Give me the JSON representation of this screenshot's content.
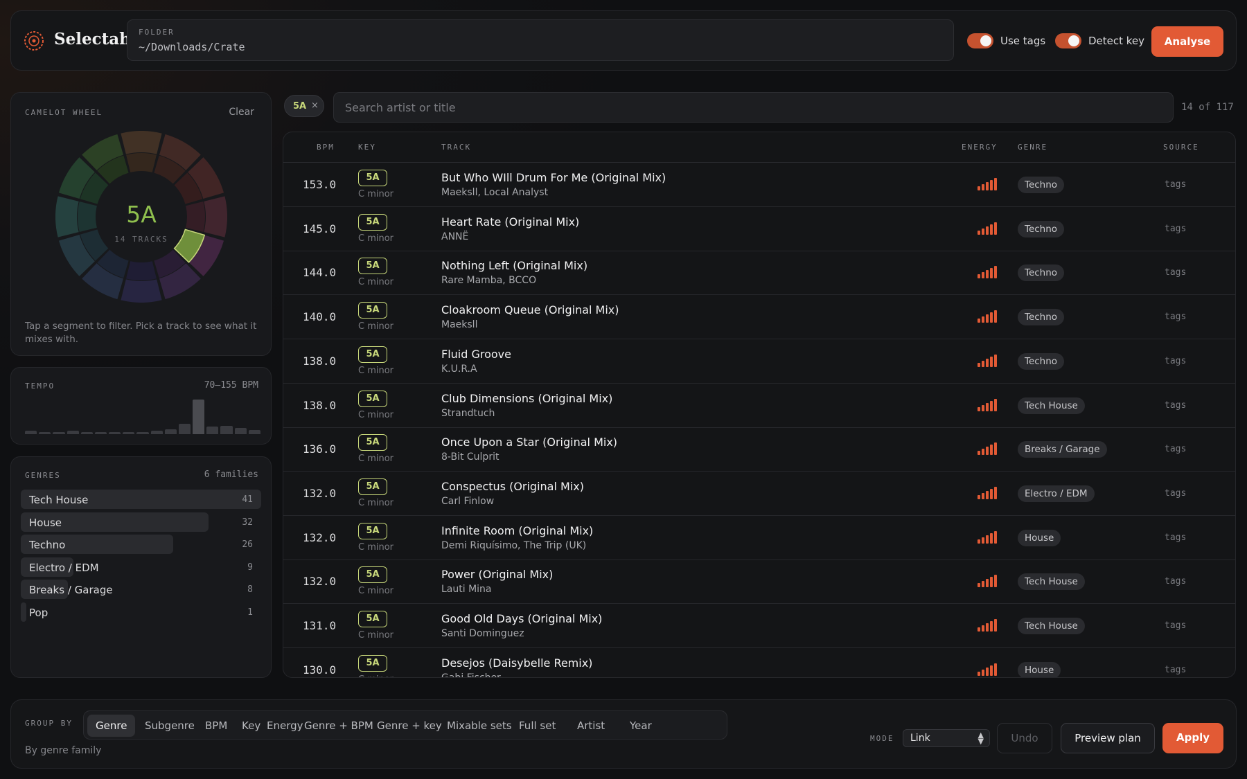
{
  "app": {
    "title": "Selectah"
  },
  "folder": {
    "label": "FOLDER",
    "path": "~/Downloads/Crate"
  },
  "toggles": {
    "use_tags": "Use tags",
    "detect_key": "Detect key"
  },
  "analyse_label": "Analyse",
  "colors": {
    "accent": "#e25a35",
    "key_green": "#c7d77a",
    "wheel_selected": "#6f8f3b"
  },
  "camelot": {
    "label": "CAMELOT WHEEL",
    "clear": "Clear",
    "selected_key": "5A",
    "track_count": "14 TRACKS",
    "hint": "Tap a segment to filter. Pick a track to see what it mixes with."
  },
  "tempo": {
    "label": "TEMPO",
    "range": "70–155 BPM",
    "histogram": [
      0.1,
      0.04,
      0.04,
      0.1,
      0.04,
      0.04,
      0.04,
      0.04,
      0.04,
      0.1,
      0.15,
      0.3,
      1.0,
      0.22,
      0.25,
      0.18,
      0.12
    ]
  },
  "genres": {
    "label": "GENRES",
    "meta": "6 families",
    "items": [
      {
        "name": "Tech House",
        "count": "41",
        "value": 41
      },
      {
        "name": "House",
        "count": "32",
        "value": 32
      },
      {
        "name": "Techno",
        "count": "26",
        "value": 26
      },
      {
        "name": "Electro / EDM",
        "count": "9",
        "value": 9
      },
      {
        "name": "Breaks / Garage",
        "count": "8",
        "value": 8
      },
      {
        "name": "Pop",
        "count": "1",
        "value": 1
      }
    ]
  },
  "filter": {
    "chip": "5A",
    "chip_close": "×",
    "search_placeholder": "Search artist or title",
    "result_count": "14 of 117"
  },
  "table": {
    "headers": {
      "bpm": "BPM",
      "key": "KEY",
      "track": "TRACK",
      "energy": "ENERGY",
      "genre": "GENRE",
      "source": "SOURCE"
    },
    "rows": [
      {
        "bpm": "153.0",
        "key": "5A",
        "key_name": "C minor",
        "title": "But Who WIll Drum For Me (Original Mix)",
        "artist": "Maeksll, Local Analyst",
        "genre": "Techno",
        "source": "tags",
        "energy": 5
      },
      {
        "bpm": "145.0",
        "key": "5A",
        "key_name": "C minor",
        "title": "Heart Rate (Original Mix)",
        "artist": "ANNË",
        "genre": "Techno",
        "source": "tags",
        "energy": 5
      },
      {
        "bpm": "144.0",
        "key": "5A",
        "key_name": "C minor",
        "title": "Nothing Left (Original Mix)",
        "artist": "Rare Mamba, BCCO",
        "genre": "Techno",
        "source": "tags",
        "energy": 5
      },
      {
        "bpm": "140.0",
        "key": "5A",
        "key_name": "C minor",
        "title": "Cloakroom Queue (Original Mix)",
        "artist": "Maeksll",
        "genre": "Techno",
        "source": "tags",
        "energy": 5
      },
      {
        "bpm": "138.0",
        "key": "5A",
        "key_name": "C minor",
        "title": "Fluid Groove",
        "artist": "K.U.R.A",
        "genre": "Techno",
        "source": "tags",
        "energy": 5
      },
      {
        "bpm": "138.0",
        "key": "5A",
        "key_name": "C minor",
        "title": "Club Dimensions (Original Mix)",
        "artist": "Strandtuch",
        "genre": "Tech House",
        "source": "tags",
        "energy": 5
      },
      {
        "bpm": "136.0",
        "key": "5A",
        "key_name": "C minor",
        "title": "Once Upon a Star (Original Mix)",
        "artist": "8-Bit Culprit",
        "genre": "Breaks / Garage",
        "source": "tags",
        "energy": 5
      },
      {
        "bpm": "132.0",
        "key": "5A",
        "key_name": "C minor",
        "title": "Conspectus (Original Mix)",
        "artist": "Carl Finlow",
        "genre": "Electro / EDM",
        "source": "tags",
        "energy": 5
      },
      {
        "bpm": "132.0",
        "key": "5A",
        "key_name": "C minor",
        "title": "Infinite Room (Original Mix)",
        "artist": "Demi Riquísimo, The Trip (UK)",
        "genre": "House",
        "source": "tags",
        "energy": 5
      },
      {
        "bpm": "132.0",
        "key": "5A",
        "key_name": "C minor",
        "title": "Power (Original Mix)",
        "artist": "Lauti Mina",
        "genre": "Tech House",
        "source": "tags",
        "energy": 5
      },
      {
        "bpm": "131.0",
        "key": "5A",
        "key_name": "C minor",
        "title": "Good Old Days (Original Mix)",
        "artist": "Santi Dominguez",
        "genre": "Tech House",
        "source": "tags",
        "energy": 5
      },
      {
        "bpm": "130.0",
        "key": "5A",
        "key_name": "C minor",
        "title": "Desejos (Daisybelle Remix)",
        "artist": "Gabi Fischer",
        "genre": "House",
        "source": "tags",
        "energy": 5
      }
    ]
  },
  "group_by": {
    "label": "GROUP BY",
    "tabs": [
      "Genre",
      "Subgenre",
      "BPM",
      "Key",
      "Energy",
      "Genre + BPM",
      "Genre + key",
      "Mixable sets",
      "Full set",
      "Artist",
      "Year"
    ],
    "active": "Genre",
    "subtitle": "By genre family"
  },
  "mode": {
    "label": "MODE",
    "value": "Link"
  },
  "actions": {
    "undo": "Undo",
    "preview": "Preview plan",
    "apply": "Apply"
  }
}
